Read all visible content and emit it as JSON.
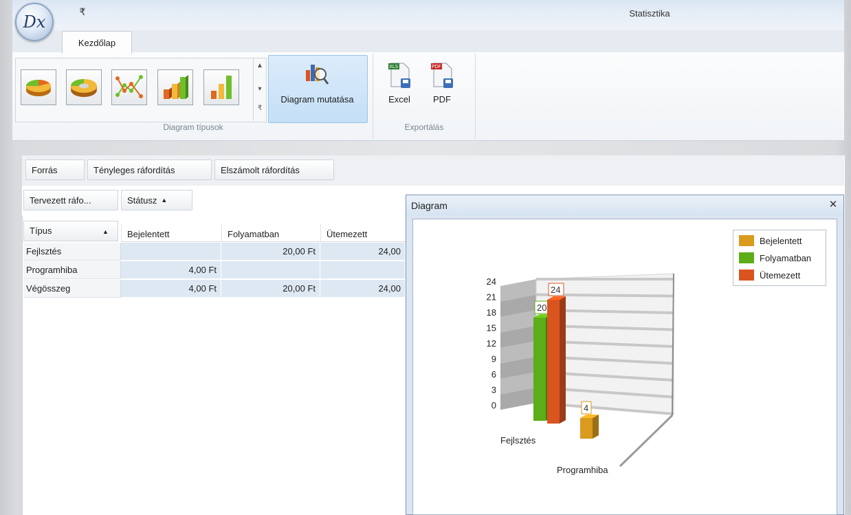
{
  "window": {
    "title": "Statisztika",
    "logo_text": "Dx",
    "qat_glyph": "₹"
  },
  "ribbon": {
    "tab": "Kezdőlap",
    "diagram_group": {
      "label": "Diagram típusok",
      "gallery_items": [
        "pie-3d-icon",
        "doughnut-3d-icon",
        "line-chart-icon",
        "bar-3d-icon",
        "bar-chart-icon"
      ],
      "show_button_label": "Diagram mutatása"
    },
    "export_group": {
      "label": "Exportálás",
      "excel_label": "Excel",
      "pdf_label": "PDF",
      "excel_badge": "XLS",
      "pdf_badge": "PDF"
    }
  },
  "pivot": {
    "filter_fields": [
      "Forrás",
      "Tényleges ráfordítás",
      "Elszámolt ráfordítás"
    ],
    "data_fields": [
      "Tervezett ráfo...",
      "Státusz"
    ],
    "row_field": "Típus",
    "columns": [
      "Bejelentett",
      "Folyamatban",
      "Ütemezett"
    ],
    "rows": [
      {
        "label": "Fejlsztés",
        "values": [
          "",
          "20,00 Ft",
          "24,00"
        ]
      },
      {
        "label": "Programhiba",
        "values": [
          "4,00 Ft",
          "",
          ""
        ]
      },
      {
        "label": "Végösszeg",
        "values": [
          "4,00 Ft",
          "20,00 Ft",
          "24,00"
        ]
      }
    ]
  },
  "diagram_window": {
    "title": "Diagram",
    "close_glyph": "✕"
  },
  "chart_data": {
    "type": "bar",
    "categories": [
      "Fejlsztés",
      "Programhiba"
    ],
    "series": [
      {
        "name": "Bejelentett",
        "values": [
          0,
          4
        ],
        "color": "#d99a1e"
      },
      {
        "name": "Folyamatban",
        "values": [
          20,
          0
        ],
        "color": "#5cad17"
      },
      {
        "name": "Ütemezett",
        "values": [
          24,
          0
        ],
        "color": "#d9541e"
      }
    ],
    "y_ticks": [
      0,
      3,
      6,
      9,
      12,
      15,
      18,
      21,
      24
    ],
    "ylim": [
      0,
      24
    ],
    "legend": "top-right",
    "data_labels": true,
    "three_d": true
  }
}
